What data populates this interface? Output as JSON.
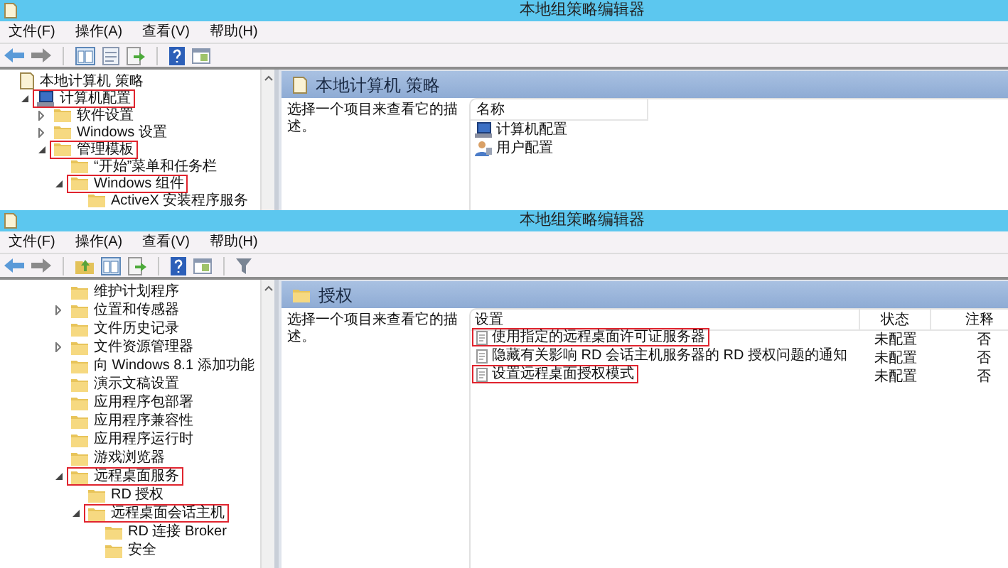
{
  "windows": [
    {
      "title": "本地组策略编辑器",
      "menu": [
        "文件(F)",
        "操作(A)",
        "查看(V)",
        "帮助(H)"
      ],
      "toolbar": [
        {
          "kind": "back"
        },
        {
          "kind": "forward"
        },
        {
          "kind": "sep"
        },
        {
          "kind": "tree"
        },
        {
          "kind": "properties"
        },
        {
          "kind": "export"
        },
        {
          "kind": "sep"
        },
        {
          "kind": "help"
        },
        {
          "kind": "pane"
        }
      ],
      "tree": [
        {
          "label": "本地计算机 策略",
          "kind": "doc",
          "highlighted": false,
          "children": [
            {
              "label": "计算机配置",
              "kind": "computer",
              "expanded": true,
              "highlighted": true,
              "children": [
                {
                  "label": "软件设置",
                  "kind": "folder",
                  "expanded": false,
                  "highlighted": false
                },
                {
                  "label": "Windows 设置",
                  "kind": "folder",
                  "expanded": false,
                  "highlighted": false
                },
                {
                  "label": "管理模板",
                  "kind": "folder",
                  "expanded": true,
                  "highlighted": true,
                  "children": [
                    {
                      "label": "“开始”菜单和任务栏",
                      "kind": "folder",
                      "highlighted": false
                    },
                    {
                      "label": "Windows 组件",
                      "kind": "folder",
                      "expanded": true,
                      "highlighted": true,
                      "children": [
                        {
                          "label": "ActiveX 安装程序服务",
                          "kind": "folder",
                          "highlighted": false
                        }
                      ]
                    }
                  ]
                }
              ]
            }
          ]
        }
      ],
      "pane": {
        "kind": "list",
        "header": "本地计算机 策略",
        "description": "选择一个项目来查看它的描述。",
        "columns": [
          "名称"
        ],
        "items": [
          {
            "label": "计算机配置",
            "kind": "computer"
          },
          {
            "label": "用户配置",
            "kind": "user"
          }
        ]
      }
    },
    {
      "title": "本地组策略编辑器",
      "menu": [
        "文件(F)",
        "操作(A)",
        "查看(V)",
        "帮助(H)"
      ],
      "toolbar": [
        {
          "kind": "back"
        },
        {
          "kind": "forward"
        },
        {
          "kind": "sep"
        },
        {
          "kind": "up"
        },
        {
          "kind": "tree"
        },
        {
          "kind": "export"
        },
        {
          "kind": "sep"
        },
        {
          "kind": "help"
        },
        {
          "kind": "pane"
        },
        {
          "kind": "sep"
        },
        {
          "kind": "filter"
        }
      ],
      "tree": [
        {
          "label": "维护计划程序",
          "kind": "folder",
          "highlighted": false
        },
        {
          "label": "位置和传感器",
          "kind": "folder",
          "expanded": false,
          "highlighted": false
        },
        {
          "label": "文件历史记录",
          "kind": "folder",
          "highlighted": false
        },
        {
          "label": "文件资源管理器",
          "kind": "folder",
          "expanded": false,
          "highlighted": false
        },
        {
          "label": "向 Windows 8.1 添加功能",
          "kind": "folder",
          "highlighted": false
        },
        {
          "label": "演示文稿设置",
          "kind": "folder",
          "highlighted": false
        },
        {
          "label": "应用程序包部署",
          "kind": "folder",
          "highlighted": false
        },
        {
          "label": "应用程序兼容性",
          "kind": "folder",
          "highlighted": false
        },
        {
          "label": "应用程序运行时",
          "kind": "folder",
          "highlighted": false
        },
        {
          "label": "游戏浏览器",
          "kind": "folder",
          "highlighted": false
        },
        {
          "label": "远程桌面服务",
          "kind": "folder",
          "expanded": true,
          "highlighted": true,
          "children": [
            {
              "label": "RD 授权",
              "kind": "folder",
              "highlighted": false
            },
            {
              "label": "远程桌面会话主机",
              "kind": "folder",
              "expanded": true,
              "highlighted": true,
              "children": [
                {
                  "label": "RD 连接 Broker",
                  "kind": "folder",
                  "highlighted": false
                },
                {
                  "label": "安全",
                  "kind": "folder",
                  "highlighted": false
                }
              ]
            }
          ]
        }
      ],
      "pane": {
        "kind": "table",
        "header": "授权",
        "description": "选择一个项目来查看它的描述。",
        "columns": [
          "设置",
          "状态",
          "注释"
        ],
        "rows": [
          {
            "setting": "使用指定的远程桌面许可证服务器",
            "status": "未配置",
            "note": "否",
            "highlighted": true
          },
          {
            "setting": "隐藏有关影响 RD 会话主机服务器的 RD 授权问题的通知",
            "status": "未配置",
            "note": "否",
            "highlighted": false
          },
          {
            "setting": "设置远程桌面授权模式",
            "status": "未配置",
            "note": "否",
            "highlighted": true
          }
        ]
      }
    }
  ]
}
